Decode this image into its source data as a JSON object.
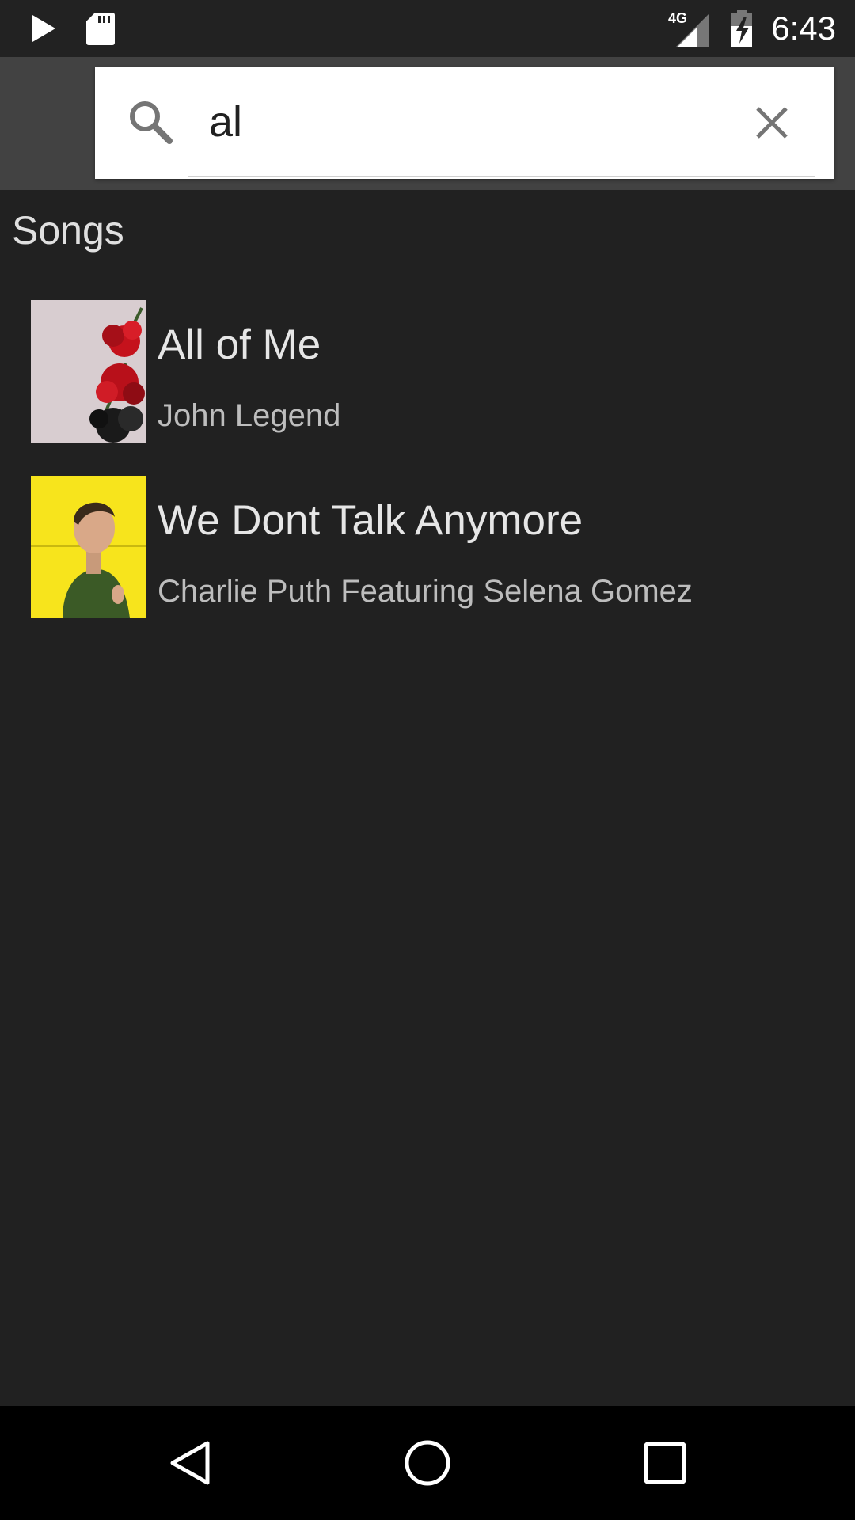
{
  "status_bar": {
    "time": "6:43",
    "network": "4G",
    "icons": [
      "play-store-icon",
      "sd-card-icon",
      "signal-icon",
      "battery-charging-icon"
    ]
  },
  "search": {
    "query": "al",
    "icon": "search-icon",
    "clear_icon": "close-icon"
  },
  "results": {
    "section_title": "Songs",
    "songs": [
      {
        "title": "All of Me",
        "artist": "John Legend",
        "art_icon": "album-art-roses"
      },
      {
        "title": "We Dont Talk Anymore",
        "artist": "Charlie Puth Featuring Selena Gomez",
        "art_icon": "album-art-portrait"
      }
    ]
  },
  "nav": {
    "back": "back-icon",
    "home": "home-icon",
    "recents": "recents-icon"
  },
  "colors": {
    "background": "#212121",
    "header": "#424242",
    "search_box": "#ffffff",
    "text_primary": "#e6e6e6",
    "text_secondary": "#bdbdbd"
  }
}
